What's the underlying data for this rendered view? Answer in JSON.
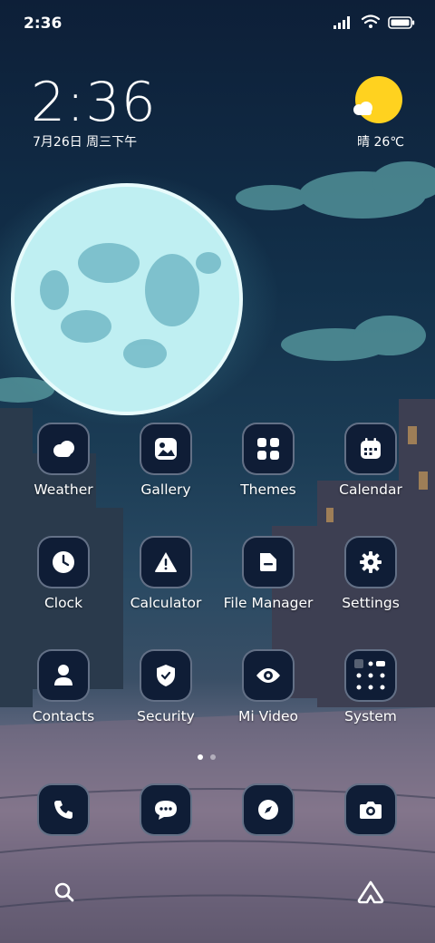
{
  "status_bar": {
    "time": "2:36"
  },
  "lockclock": {
    "time": "2:36",
    "date": "7月26日 周三下午"
  },
  "weather_widget": {
    "condition_temp": "晴 26℃"
  },
  "apps": [
    {
      "label": "Weather"
    },
    {
      "label": "Gallery"
    },
    {
      "label": "Themes"
    },
    {
      "label": "Calendar"
    },
    {
      "label": "Clock"
    },
    {
      "label": "Calculator"
    },
    {
      "label": "File Manager"
    },
    {
      "label": "Settings"
    },
    {
      "label": "Contacts"
    },
    {
      "label": "Security"
    },
    {
      "label": "Mi Video"
    },
    {
      "label": "System"
    }
  ],
  "dock": [
    "phone-icon",
    "messages-icon",
    "browser-icon",
    "camera-icon"
  ],
  "colors": {
    "icon_bg": "#0f1d36",
    "sun": "#ffd21f"
  }
}
